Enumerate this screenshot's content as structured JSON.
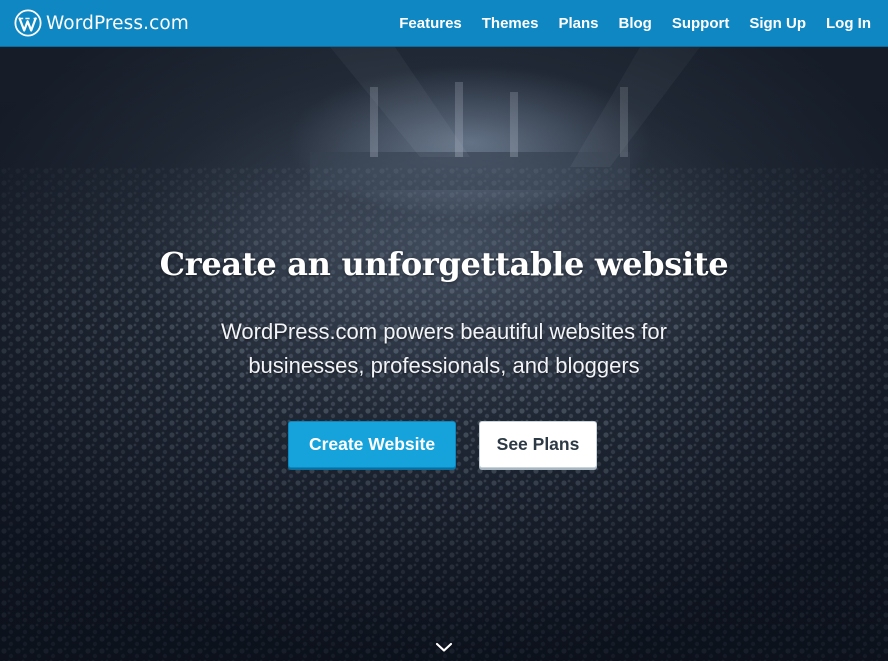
{
  "header": {
    "brand": "WordPress.com",
    "nav": [
      {
        "label": "Features"
      },
      {
        "label": "Themes"
      },
      {
        "label": "Plans"
      },
      {
        "label": "Blog"
      },
      {
        "label": "Support"
      },
      {
        "label": "Sign Up"
      },
      {
        "label": "Log In"
      }
    ],
    "background_color": "#0f87c3"
  },
  "hero": {
    "title": "Create an unforgettable website",
    "subtitle": "WordPress.com powers beautiful websites for businesses, professionals, and bloggers",
    "primary_button": "Create Website",
    "secondary_button": "See Plans",
    "scroll_icon": "chevron-down-icon",
    "background_image": "concert-crowd-photo",
    "accent_color": "#16a3dc"
  }
}
